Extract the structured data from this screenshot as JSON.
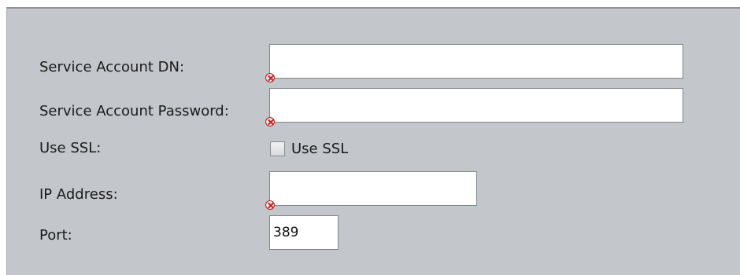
{
  "form": {
    "service_account_dn": {
      "label": "Service Account DN:",
      "value": "",
      "error_icon": "validation-error-icon"
    },
    "service_account_password": {
      "label": "Service Account Password:",
      "value": "",
      "error_icon": "validation-error-icon"
    },
    "use_ssl": {
      "label": "Use SSL:",
      "checkbox_label": "Use SSL",
      "checked": false
    },
    "ip_address": {
      "label": "IP Address:",
      "value": "",
      "error_icon": "validation-error-icon"
    },
    "port": {
      "label": "Port:",
      "value": "389"
    }
  },
  "colors": {
    "panel_background": "#c3c6cb",
    "error_red": "#c81e1e"
  }
}
